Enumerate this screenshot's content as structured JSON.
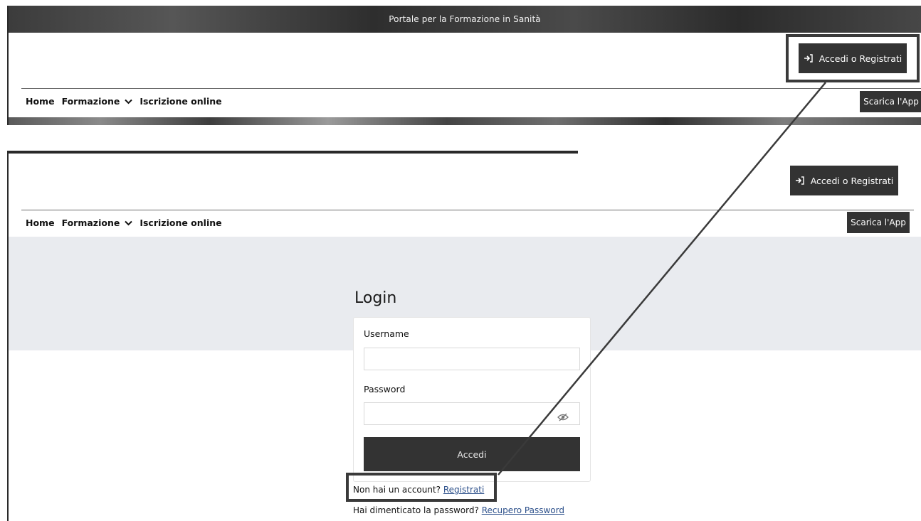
{
  "header": {
    "site_title": "Portale per la Formazione in Sanità",
    "login_button": "Accedi o Registrati",
    "app_button": "Scarica l'App"
  },
  "nav": {
    "items": [
      "Home",
      "Formazione",
      "Iscrizione online"
    ]
  },
  "login": {
    "title": "Login",
    "username_label": "Username",
    "username_value": "",
    "password_label": "Password",
    "password_value": "",
    "submit": "Accedi",
    "no_account_text": "Non hai un account?",
    "register_link": "Registrati",
    "forgot_text": "Hai dimenticato la password?",
    "recover_link": "Recupero Password"
  },
  "icons": {
    "login": "sign-in-icon",
    "dropdown": "chevron-down-icon",
    "password_toggle": "eye-slash-icon"
  },
  "colors": {
    "dark_button": "#333333",
    "link": "#2b4f8a",
    "annotation": "#3a3a3a"
  }
}
